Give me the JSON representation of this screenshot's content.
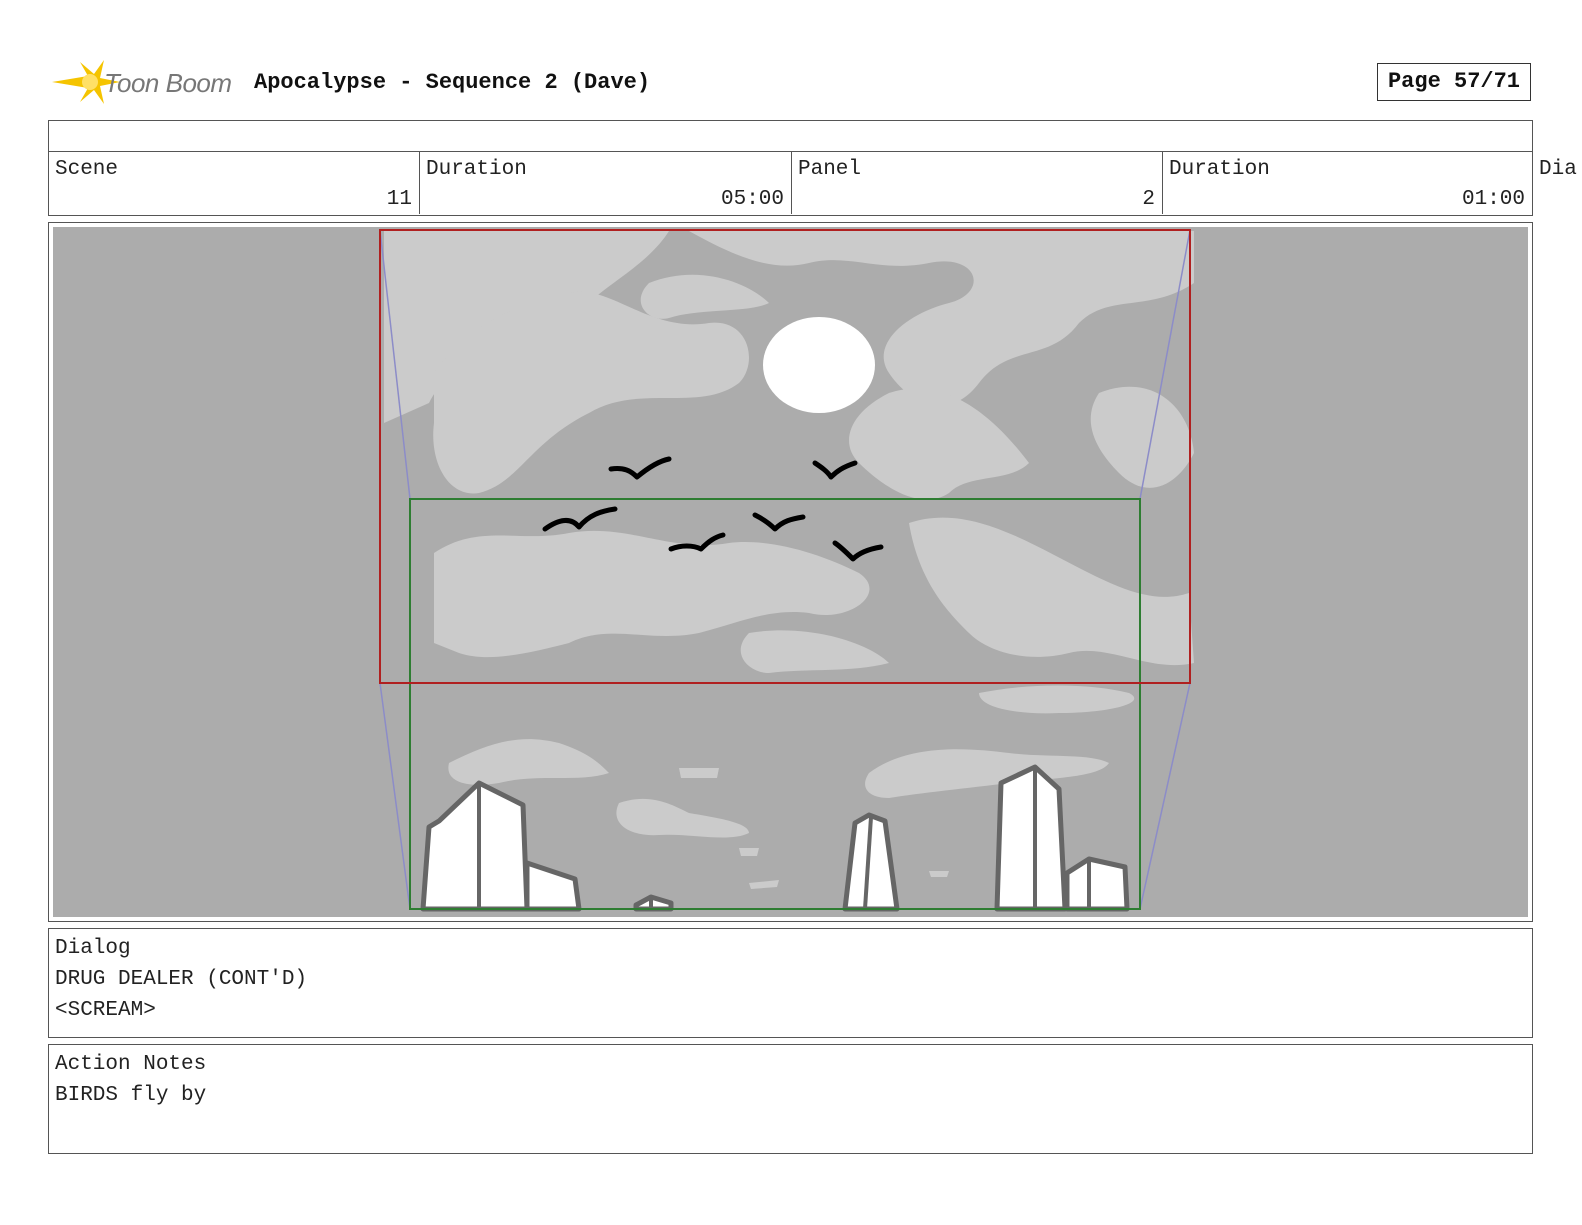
{
  "header": {
    "logo_text": "Toon Boom",
    "title": "Apocalypse - Sequence 2 (Dave)",
    "page": "Page 57/71"
  },
  "info": {
    "scene_label": "Scene",
    "scene_value": "11",
    "scene_duration_label": "Duration",
    "scene_duration_value": "05:00",
    "panel_label": "Panel",
    "panel_value": "2",
    "panel_duration_label": "Duration",
    "panel_duration_value": "01:00",
    "overflow_label": "Dia"
  },
  "dialog": {
    "label": "Dialog",
    "character": "DRUG DEALER (CONT'D)",
    "line": "<SCREAM>"
  },
  "action_notes": {
    "label": "Action Notes",
    "text": "BIRDS fly by"
  },
  "colors": {
    "panel_background": "#acacac",
    "cloud_light": "#cbcbcb",
    "start_frame": "#b02020",
    "end_frame": "#2e7d32",
    "camera_guides": "#8c8cc8",
    "logo_accent": "#f5c400"
  }
}
